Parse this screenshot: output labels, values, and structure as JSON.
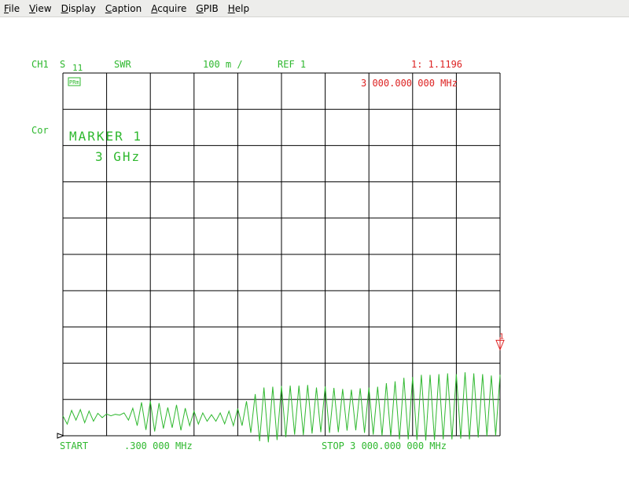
{
  "menu": [
    {
      "first": "F",
      "rest": "ile"
    },
    {
      "first": "V",
      "rest": "iew"
    },
    {
      "first": "D",
      "rest": "isplay"
    },
    {
      "first": "C",
      "rest": "aption"
    },
    {
      "first": "A",
      "rest": "cquire"
    },
    {
      "first": "G",
      "rest": "PIB"
    },
    {
      "first": "H",
      "rest": "elp"
    }
  ],
  "header": {
    "channel": "CH1",
    "param": "S",
    "param_sub": "11",
    "format": "SWR",
    "scale": "100 m /",
    "ref": "REF 1",
    "marker_readout": "1: 1.1196",
    "marker_freq": "3 000.000 000 MHz"
  },
  "side": {
    "cor": "Cor",
    "badge": "PRm"
  },
  "marker_annotation": {
    "line1": "MARKER 1",
    "line2": "3 GHz",
    "marker_label": "1"
  },
  "footer": {
    "start": "START",
    "start_freq": ".300 000 MHz",
    "stop": "STOP 3 000.000 000 MHz"
  },
  "colors": {
    "trace": "#2fb82f",
    "annotation": "#2fb82f",
    "marker": "#dd2222",
    "grid": "#000000"
  },
  "chart_data": {
    "type": "line",
    "x_range_mhz": [
      0.3,
      3000
    ],
    "ylim": [
      0.1,
      1.1
    ],
    "ref_value": 1,
    "scale_per_div": 0.1,
    "grid": true,
    "series": [
      {
        "x": [
          0.3,
          30,
          60,
          90,
          120,
          150,
          180,
          210,
          240,
          270,
          300,
          330,
          360,
          390,
          420,
          450,
          480,
          510,
          540,
          570,
          600,
          630,
          660,
          690,
          720,
          750,
          780,
          810,
          840,
          870,
          900,
          930,
          960,
          990,
          1020,
          1050,
          1080,
          1110,
          1140,
          1170,
          1200,
          1230,
          1260,
          1290,
          1320,
          1350,
          1380,
          1410,
          1440,
          1470,
          1500,
          1530,
          1560,
          1590,
          1620,
          1650,
          1680,
          1710,
          1740,
          1770,
          1800,
          1830,
          1860,
          1890,
          1920,
          1950,
          1980,
          2010,
          2040,
          2070,
          2100,
          2130,
          2160,
          2190,
          2220,
          2250,
          2280,
          2310,
          2340,
          2370,
          2400,
          2430,
          2460,
          2490,
          2520,
          2550,
          2580,
          2610,
          2640,
          2670,
          2700,
          2730,
          2760,
          2790,
          2820,
          2850,
          2880,
          2910,
          2940,
          2970,
          3000
        ],
        "y": [
          0.155,
          0.132,
          0.17,
          0.143,
          0.172,
          0.136,
          0.168,
          0.14,
          0.162,
          0.15,
          0.16,
          0.155,
          0.159,
          0.157,
          0.163,
          0.143,
          0.176,
          0.128,
          0.192,
          0.116,
          0.195,
          0.112,
          0.19,
          0.12,
          0.178,
          0.122,
          0.185,
          0.115,
          0.176,
          0.128,
          0.168,
          0.132,
          0.163,
          0.14,
          0.158,
          0.14,
          0.163,
          0.133,
          0.168,
          0.128,
          0.175,
          0.128,
          0.195,
          0.108,
          0.215,
          0.085,
          0.233,
          0.082,
          0.235,
          0.088,
          0.237,
          0.096,
          0.238,
          0.103,
          0.238,
          0.102,
          0.24,
          0.106,
          0.233,
          0.11,
          0.236,
          0.108,
          0.232,
          0.11,
          0.229,
          0.114,
          0.227,
          0.115,
          0.231,
          0.108,
          0.233,
          0.103,
          0.235,
          0.1,
          0.245,
          0.098,
          0.25,
          0.09,
          0.26,
          0.09,
          0.262,
          0.088,
          0.268,
          0.087,
          0.268,
          0.088,
          0.27,
          0.09,
          0.272,
          0.09,
          0.27,
          0.092,
          0.275,
          0.09,
          0.272,
          0.095,
          0.27,
          0.098,
          0.266,
          0.1,
          0.268
        ]
      }
    ],
    "marker": {
      "x": 3000,
      "y": 1.1196
    }
  }
}
